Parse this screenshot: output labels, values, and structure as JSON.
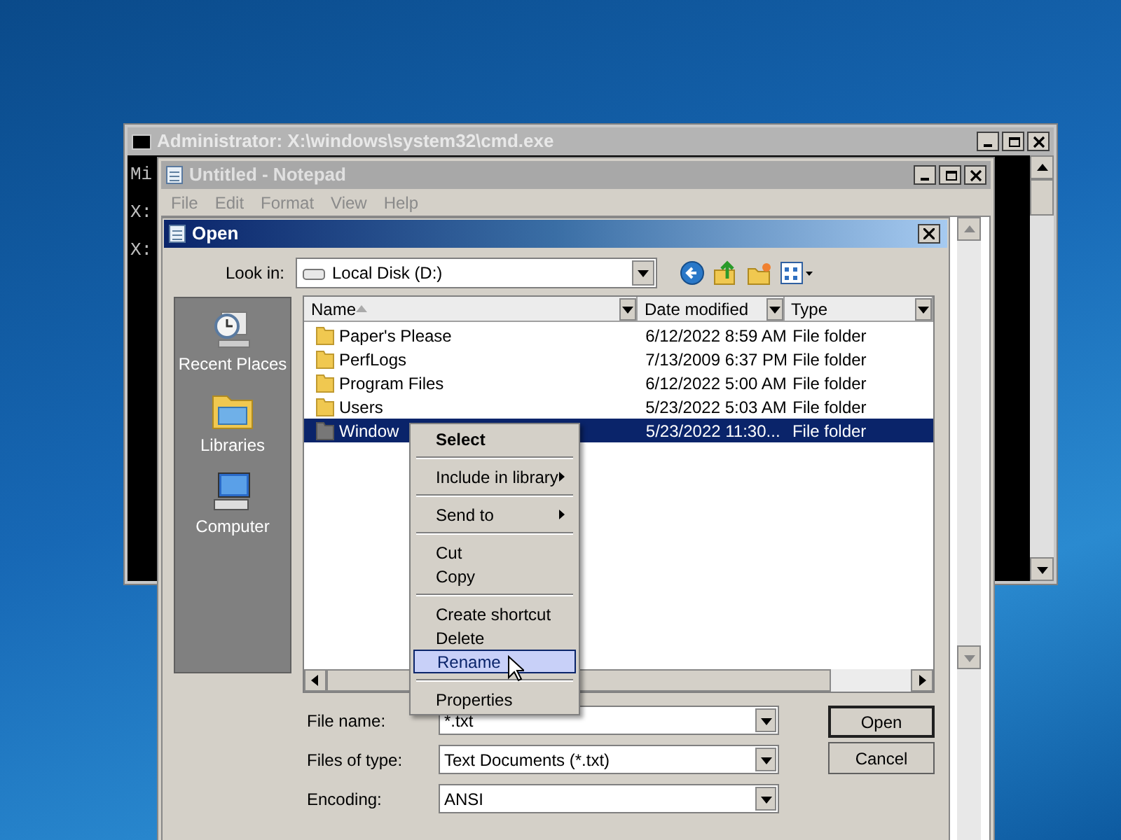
{
  "cmd_window": {
    "title": "Administrator: X:\\windows\\system32\\cmd.exe",
    "console_lines": [
      "Mi",
      "X:",
      "X:"
    ]
  },
  "notepad_window": {
    "title": "Untitled - Notepad",
    "menu": [
      "File",
      "Edit",
      "Format",
      "View",
      "Help"
    ]
  },
  "open_dialog": {
    "title": "Open",
    "look_in": {
      "label": "Look in:",
      "value": "Local Disk (D:)"
    },
    "places": [
      {
        "label": "Recent Places",
        "kind": "recent"
      },
      {
        "label": "Libraries",
        "kind": "libraries"
      },
      {
        "label": "Computer",
        "kind": "computer"
      }
    ],
    "columns": [
      "Name",
      "Date modified",
      "Type"
    ],
    "rows": [
      {
        "name": "Paper's Please",
        "date": "6/12/2022 8:59 AM",
        "type": "File folder",
        "selected": false
      },
      {
        "name": "PerfLogs",
        "date": "7/13/2009 6:37 PM",
        "type": "File folder",
        "selected": false
      },
      {
        "name": "Program Files",
        "date": "6/12/2022 5:00 AM",
        "type": "File folder",
        "selected": false
      },
      {
        "name": "Users",
        "date": "5/23/2022 5:03 AM",
        "type": "File folder",
        "selected": false
      },
      {
        "name": "Window",
        "date": "5/23/2022 11:30...",
        "type": "File folder",
        "selected": true
      }
    ],
    "context_menu": [
      [
        {
          "label": "Select",
          "default": true,
          "submenu": false,
          "selected": false
        }
      ],
      [
        {
          "label": "Include in library",
          "default": false,
          "submenu": true,
          "selected": false
        }
      ],
      [
        {
          "label": "Send to",
          "default": false,
          "submenu": true,
          "selected": false
        }
      ],
      [
        {
          "label": "Cut",
          "default": false,
          "submenu": false,
          "selected": false
        },
        {
          "label": "Copy",
          "default": false,
          "submenu": false,
          "selected": false
        }
      ],
      [
        {
          "label": "Create shortcut",
          "default": false,
          "submenu": false,
          "selected": false
        },
        {
          "label": "Delete",
          "default": false,
          "submenu": false,
          "selected": false
        },
        {
          "label": "Rename",
          "default": false,
          "submenu": false,
          "selected": true
        }
      ],
      [
        {
          "label": "Properties",
          "default": false,
          "submenu": false,
          "selected": false
        }
      ]
    ],
    "fields": [
      {
        "label": "File name:",
        "value": "*.txt"
      },
      {
        "label": "Files of type:",
        "value": "Text Documents (*.txt)"
      },
      {
        "label": "Encoding:",
        "value": "ANSI"
      }
    ],
    "buttons": [
      "Open",
      "Cancel"
    ]
  }
}
